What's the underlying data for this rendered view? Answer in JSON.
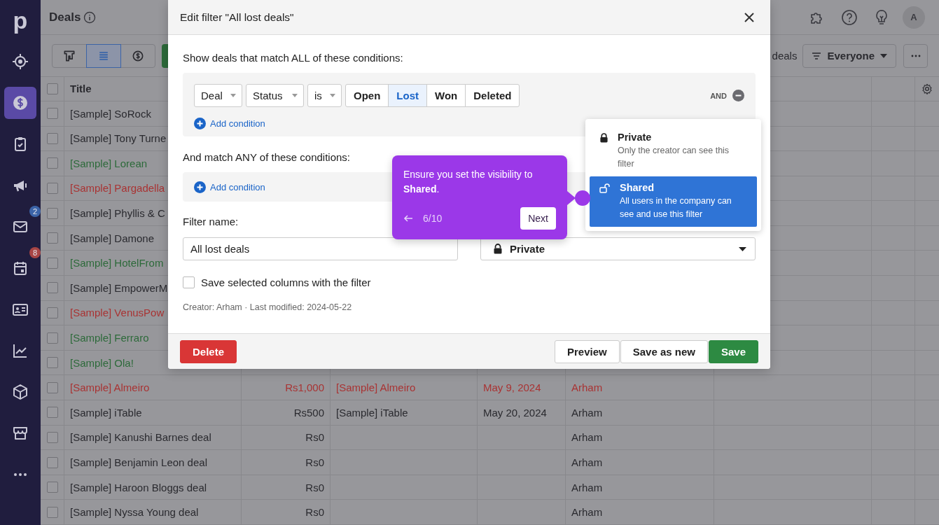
{
  "sidebar": {
    "logo": "p",
    "items": [
      {
        "selected": false
      },
      {
        "selected": true
      },
      {
        "selected": false
      },
      {
        "selected": false
      },
      {
        "selected": false,
        "badge": "2",
        "color": "#3c64a8"
      },
      {
        "selected": false,
        "badge": "8",
        "color": "#a84545"
      },
      {
        "selected": false
      },
      {
        "selected": false
      },
      {
        "selected": false
      },
      {
        "selected": false
      },
      {
        "selected": false
      }
    ]
  },
  "header": {
    "title": "Deals",
    "avatar": "A"
  },
  "toolbar": {
    "views": [
      {
        "selected": false
      },
      {
        "selected": true
      },
      {
        "selected": false
      }
    ],
    "deals_label": "deals",
    "filter": "Everyone"
  },
  "table": {
    "columns": [
      "Title"
    ],
    "select_all_checked": false,
    "rows": [
      {
        "color": "#2a2a2f",
        "checked": false,
        "title": "[Sample] SoRock"
      },
      {
        "color": "#2a2a2f",
        "checked": false,
        "title": "[Sample] Tony Turne"
      },
      {
        "color": "#2d6a3a",
        "checked": false,
        "title": "[Sample] Lorean"
      },
      {
        "color": "#a93333",
        "checked": false,
        "title": "[Sample] Pargadella"
      },
      {
        "color": "#2a2a2f",
        "checked": false,
        "title": "[Sample] Phyllis & C"
      },
      {
        "color": "#2a2a2f",
        "checked": false,
        "title": "[Sample] Damone"
      },
      {
        "color": "#2d6a3a",
        "checked": false,
        "title": "[Sample] HotelFrom"
      },
      {
        "color": "#2a2a2f",
        "checked": false,
        "title": "[Sample] EmpowerM"
      },
      {
        "color": "#a93333",
        "checked": false,
        "title": "[Sample] VenusPow"
      },
      {
        "color": "#2d6a3a",
        "checked": false,
        "title": "[Sample] Ferraro"
      },
      {
        "color": "#2d6a3a",
        "checked": false,
        "title": "[Sample] Ola!"
      },
      {
        "color": "#a93333",
        "checked": false,
        "title": "[Sample] Almeiro",
        "value": "Rs1,000",
        "organization": "[Sample] Almeiro",
        "date": "May 9, 2024",
        "owner": "Arham"
      },
      {
        "color": "#2a2a2f",
        "checked": false,
        "title": "[Sample] iTable",
        "value": "Rs500",
        "organization": "[Sample] iTable",
        "date": "May 20, 2024",
        "owner": "Arham"
      },
      {
        "color": "#2a2a2f",
        "checked": false,
        "title": "[Sample] Kanushi Barnes deal",
        "value": "Rs0",
        "owner": "Arham"
      },
      {
        "color": "#2a2a2f",
        "checked": false,
        "title": "[Sample] Benjamin Leon deal",
        "value": "Rs0",
        "owner": "Arham"
      },
      {
        "color": "#2a2a2f",
        "checked": false,
        "title": "[Sample] Haroon Bloggs deal",
        "value": "Rs0",
        "owner": "Arham"
      },
      {
        "color": "#2a2a2f",
        "checked": false,
        "title": "[Sample] Nyssa Young deal",
        "value": "Rs0",
        "owner": "Arham"
      }
    ]
  },
  "modal": {
    "title": "Edit filter \"All lost deals\"",
    "all_heading": "Show deals that match ALL of these conditions:",
    "condition": {
      "selects": [
        "Deal",
        "Status",
        "is"
      ],
      "options": [
        {
          "label": "Open",
          "selected": false
        },
        {
          "label": "Lost",
          "selected": true
        },
        {
          "label": "Won",
          "selected": false
        },
        {
          "label": "Deleted",
          "selected": false
        }
      ],
      "joiner": "AND"
    },
    "add_condition_all": "Add condition",
    "any_heading": "And match ANY of these conditions:",
    "add_condition_any": "Add condition",
    "name_label": "Filter name:",
    "name_value": "All lost deals",
    "visibility_value": "Private",
    "save_columns": {
      "label": "Save selected columns with the filter",
      "checked": false
    },
    "meta": "Creator: Arham · Last modified: 2024-05-22",
    "buttons": {
      "delete": "Delete",
      "preview": "Preview",
      "save_as_new": "Save as new",
      "save": "Save"
    },
    "visibility_menu": [
      {
        "kind": "private",
        "label": "Private",
        "description": "Only the creator can see this filter",
        "selected": false
      },
      {
        "kind": "shared",
        "label": "Shared",
        "description": "All users in the company can see and use this filter",
        "selected": true
      }
    ],
    "tour": {
      "text": "Ensure you set the visibility to **Shared**.",
      "step": "6/10",
      "next": "Next"
    }
  }
}
